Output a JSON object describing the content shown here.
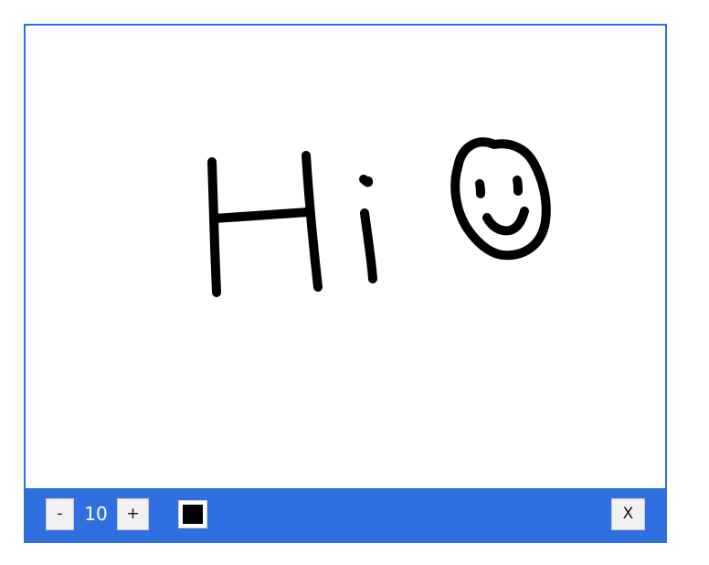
{
  "toolbar": {
    "decrease_label": "-",
    "brush_size": "10",
    "increase_label": "+",
    "close_label": "X"
  },
  "canvas": {
    "stroke_color": "#000000"
  },
  "colors": {
    "toolbar_background": "#2f6fdf",
    "border": "#2f6fdf",
    "selected_color": "#000000"
  },
  "icons": {
    "color": "color-swatch-icon"
  }
}
